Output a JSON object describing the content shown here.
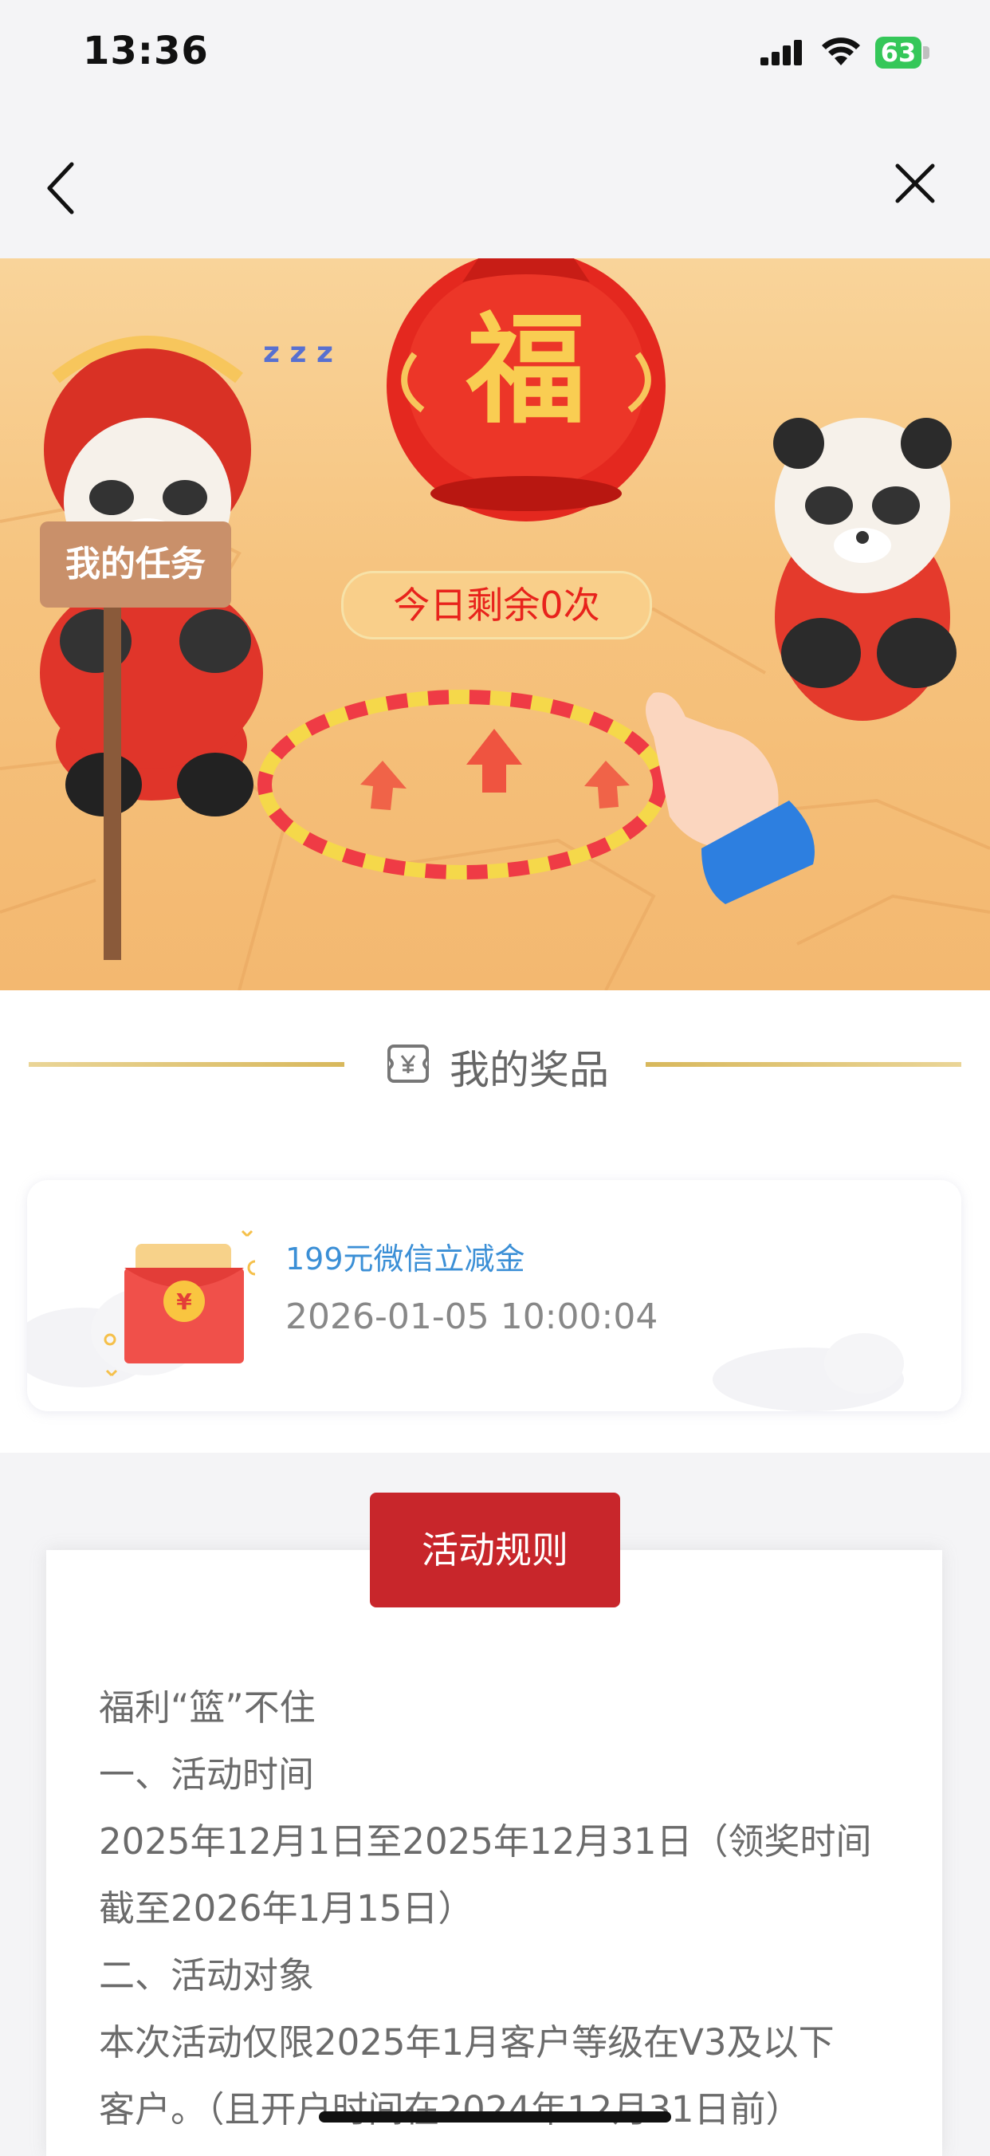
{
  "status_bar": {
    "time": "13:36",
    "battery": "63",
    "icons": [
      "cellular-signal-icon",
      "wifi-icon",
      "battery-charging-icon"
    ]
  },
  "nav": {
    "back_icon": "chevron-left-icon",
    "close_icon": "close-icon"
  },
  "banner": {
    "fu_char": "福",
    "tasks_label": "我的任务",
    "remaining_label": "今日剩余0次",
    "characters": [
      "tiger-hat-panda",
      "panda-mascot",
      "fortune-bag",
      "hoop-ring",
      "pointing-hand"
    ]
  },
  "prizes": {
    "title": "我的奖品",
    "icon": "ticket-yen-icon",
    "items": [
      {
        "name": "199元微信立减金",
        "time": "2026-01-05 10:00:04",
        "icon": "red-envelope-icon",
        "envelope_symbol": "¥"
      }
    ]
  },
  "rules": {
    "button_label": "活动规则",
    "lines": [
      "福利“篮”不住",
      "一、活动时间",
      "2025年12月1日至2025年12月31日（领奖时间",
      "截至2026年1月15日）",
      "二、活动对象",
      "本次活动仅限2025年1月客户等级在V3及以下",
      "客户。（且开户时间在2024年12月31日前）"
    ]
  },
  "colors": {
    "accent_red": "#c8262b",
    "link_blue": "#3b8fd6",
    "gold_line": "#d8b85c",
    "banner_bg": "#f6c37e"
  }
}
